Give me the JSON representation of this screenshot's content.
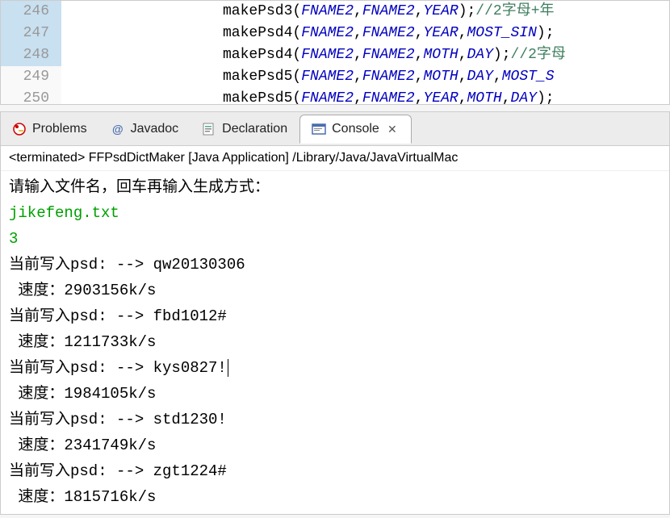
{
  "editor": {
    "lines": [
      {
        "num": "246",
        "highlight": true,
        "method": "makePsd3",
        "args": [
          "FNAME2",
          "FNAME2",
          "YEAR"
        ],
        "trail": ");",
        "comment": "//2字母+年"
      },
      {
        "num": "247",
        "highlight": true,
        "method": "makePsd4",
        "args": [
          "FNAME2",
          "FNAME2",
          "YEAR",
          "MOST_SIN"
        ],
        "trail": ");",
        "comment": ""
      },
      {
        "num": "248",
        "highlight": true,
        "method": "makePsd4",
        "args": [
          "FNAME2",
          "FNAME2",
          "MOTH",
          "DAY"
        ],
        "trail": ");",
        "comment": "//2字母"
      },
      {
        "num": "249",
        "highlight": false,
        "method": "makePsd5",
        "args": [
          "FNAME2",
          "FNAME2",
          "MOTH",
          "DAY",
          "MOST_S"
        ],
        "trail": "",
        "comment": ""
      },
      {
        "num": "250",
        "highlight": false,
        "method": "makePsd5",
        "args": [
          "FNAME2",
          "FNAME2",
          "YEAR",
          "MOTH",
          "DAY"
        ],
        "trail": ");",
        "comment": ""
      }
    ]
  },
  "tabs": {
    "problems": "Problems",
    "javadoc": "Javadoc",
    "declaration": "Declaration",
    "console": "Console"
  },
  "process": {
    "status": "<terminated>",
    "label": "FFPsdDictMaker [Java Application] /Library/Java/JavaVirtualMac"
  },
  "console": {
    "prompt": "请输入文件名，回车再输入生成方式：",
    "input1": "jikefeng.txt",
    "input2": "3",
    "lines": [
      {
        "label": "当前写入psd: --> ",
        "value": "qw20130306"
      },
      {
        "label": " 速度：",
        "value": "2903156k/s"
      },
      {
        "label": "当前写入psd: --> ",
        "value": "fbd1012#"
      },
      {
        "label": " 速度：",
        "value": "1211733k/s"
      },
      {
        "label": "当前写入psd: --> ",
        "value": "kys0827!",
        "cursor": true
      },
      {
        "label": " 速度：",
        "value": "1984105k/s"
      },
      {
        "label": "当前写入psd: --> ",
        "value": "std1230!"
      },
      {
        "label": " 速度：",
        "value": "2341749k/s"
      },
      {
        "label": "当前写入psd: --> ",
        "value": "zgt1224#"
      },
      {
        "label": " 速度：",
        "value": "1815716k/s"
      }
    ]
  }
}
